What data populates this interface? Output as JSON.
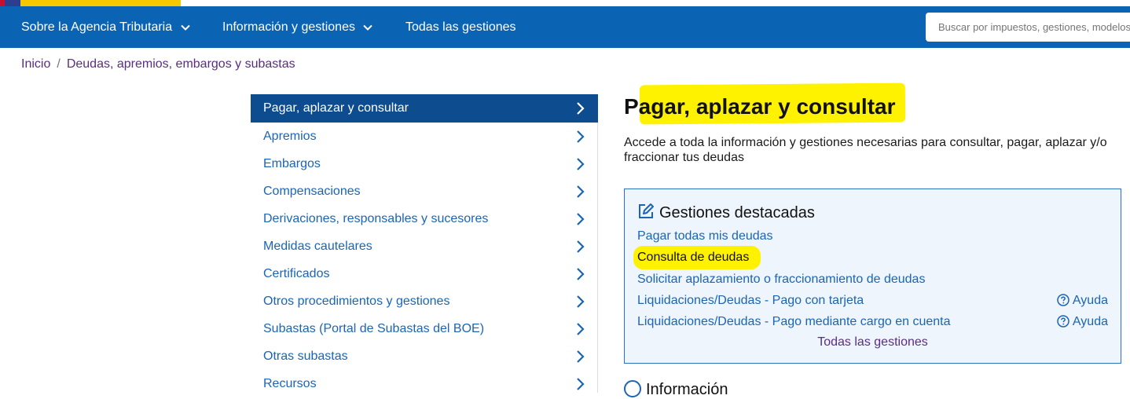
{
  "nav": {
    "items": [
      {
        "label": "Sobre la Agencia Tributaria",
        "has_dropdown": true
      },
      {
        "label": "Información y gestiones",
        "has_dropdown": true
      },
      {
        "label": "Todas las gestiones",
        "has_dropdown": false
      }
    ],
    "search_placeholder": "Buscar por impuestos, gestiones, modelos"
  },
  "breadcrumb": {
    "home": "Inicio",
    "separator": "/",
    "current": "Deudas, apremios, embargos y subastas"
  },
  "sidebar": {
    "items": [
      {
        "label": "Pagar, aplazar y consultar",
        "active": true
      },
      {
        "label": "Apremios"
      },
      {
        "label": "Embargos"
      },
      {
        "label": "Compensaciones"
      },
      {
        "label": "Derivaciones, responsables y sucesores"
      },
      {
        "label": "Medidas cautelares"
      },
      {
        "label": "Certificados"
      },
      {
        "label": "Otros procedimientos y gestiones"
      },
      {
        "label": "Subastas (Portal de Subastas del BOE)"
      },
      {
        "label": "Otras subastas"
      },
      {
        "label": "Recursos"
      }
    ]
  },
  "main": {
    "title": "Pagar, aplazar y consultar",
    "intro": "Accede a toda la información y gestiones necesarias para consultar, pagar, aplazar y/o fraccionar tus deudas",
    "featured": {
      "heading": "Gestiones destacadas",
      "links": [
        {
          "label": "Pagar todas mis deudas"
        },
        {
          "label": "Consulta de deudas",
          "highlighted": true
        },
        {
          "label": "Solicitar aplazamiento o fraccionamiento de deudas"
        },
        {
          "label": "Liquidaciones/Deudas - Pago con tarjeta",
          "help": "Ayuda"
        },
        {
          "label": "Liquidaciones/Deudas - Pago mediante cargo en cuenta",
          "help": "Ayuda"
        }
      ],
      "all_link": "Todas las gestiones"
    },
    "next_section_partial": "Información"
  },
  "colors": {
    "nav_bg": "#0a63b3",
    "active_item_bg": "#0d4c8e",
    "link": "#1a65b5",
    "visited_link": "#5a2d82",
    "highlight": "#fff200",
    "box_bg": "#eef5fc",
    "box_border": "#2c72c0"
  },
  "icons": {
    "dropdown": "chevron-down-icon",
    "side_arrow": "chevron-right-icon",
    "featured": "edit-icon",
    "help": "question-circle-icon"
  }
}
